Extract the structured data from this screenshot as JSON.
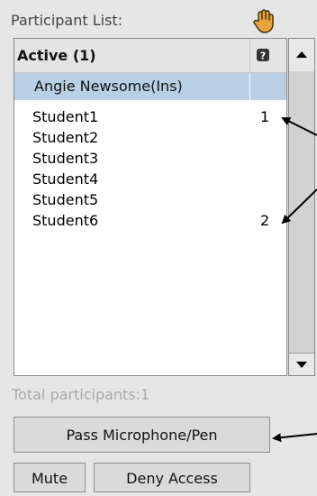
{
  "panel": {
    "header_label": "Participant List:",
    "hand_icon": "raise-hand-icon"
  },
  "list": {
    "group_title": "Active (1)",
    "column_icon": "question-icon",
    "selected_participant": "Angie Newsome(Ins)",
    "students": [
      {
        "name": "Student1",
        "number": "1"
      },
      {
        "name": "Student2",
        "number": ""
      },
      {
        "name": "Student3",
        "number": ""
      },
      {
        "name": "Student4",
        "number": ""
      },
      {
        "name": "Student5",
        "number": ""
      },
      {
        "name": "Student6",
        "number": "2"
      }
    ]
  },
  "footer": {
    "total_text": "Total participants:1",
    "pass_button": "Pass Microphone/Pen",
    "mute_button": "Mute",
    "deny_button": "Deny Access"
  },
  "colors": {
    "selection": "#b8cfe6",
    "panel_bg": "#e6e6e6",
    "hand": "#e8a33a"
  }
}
